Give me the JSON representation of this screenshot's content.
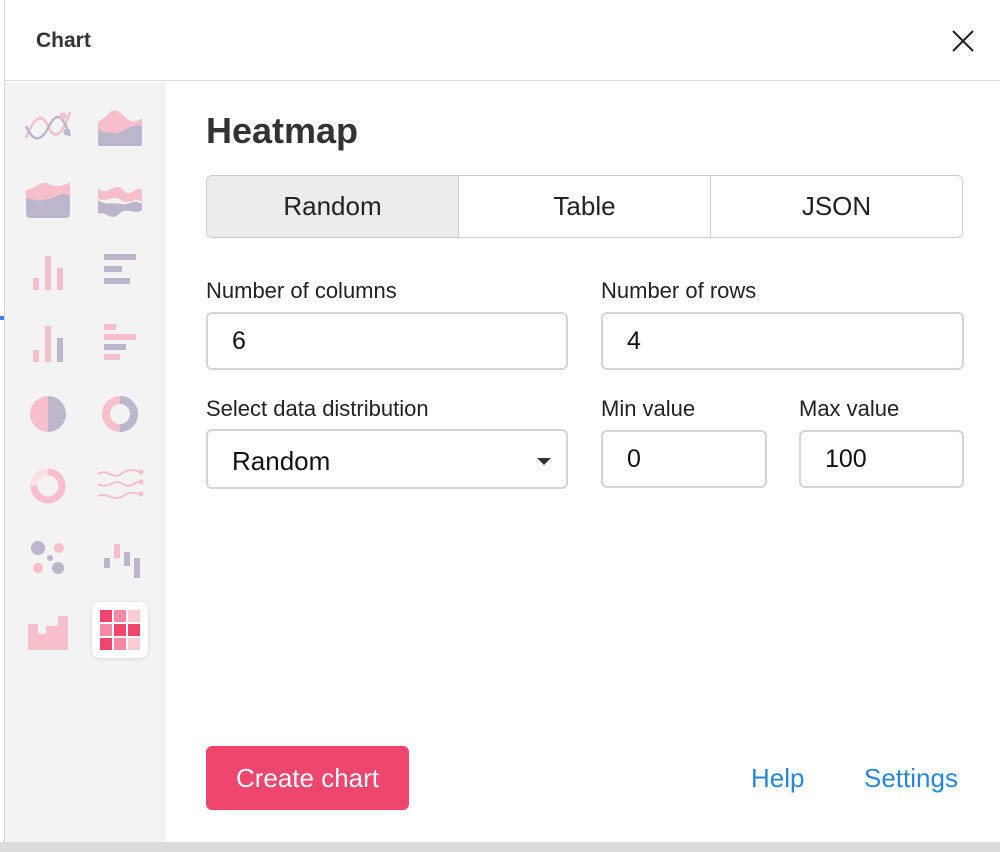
{
  "header": {
    "title": "Chart"
  },
  "sidebar": {
    "icons": [
      "line-chart-icon",
      "area-chart-icon",
      "stacked-area-chart-icon",
      "streamgraph-chart-icon",
      "column-chart-icon",
      "horizontal-bar-chart-icon",
      "grouped-column-chart-icon",
      "grouped-bar-chart-icon",
      "pie-chart-icon",
      "donut-chart-icon",
      "gauge-chart-icon",
      "wave-lines-chart-icon",
      "bubble-chart-icon",
      "waterfall-chart-icon",
      "step-area-chart-icon",
      "heatmap-chart-icon"
    ],
    "selected_icon": "heatmap-chart-icon"
  },
  "main": {
    "title": "Heatmap",
    "tabs": [
      {
        "label": "Random",
        "active": true
      },
      {
        "label": "Table",
        "active": false
      },
      {
        "label": "JSON",
        "active": false
      }
    ],
    "columns": {
      "label": "Number of columns",
      "value": "6"
    },
    "rows": {
      "label": "Number of rows",
      "value": "4"
    },
    "distribution": {
      "label": "Select data distribution",
      "value": "Random"
    },
    "min": {
      "label": "Min value",
      "value": "0"
    },
    "max": {
      "label": "Max value",
      "value": "100"
    }
  },
  "footer": {
    "create_label": "Create chart",
    "help_label": "Help",
    "settings_label": "Settings"
  },
  "colors": {
    "accent": "#ef466d",
    "link": "#2b86d8",
    "pink": "#f6bfcb",
    "lavender": "#bcb6cc",
    "heatmap_dark": "#ef466d",
    "heatmap_mid": "#f58aa5",
    "heatmap_light": "#fbcbd6"
  }
}
